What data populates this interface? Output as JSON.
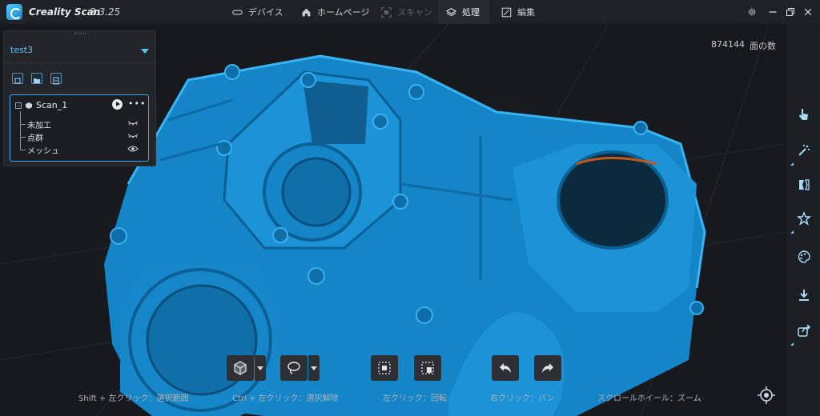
{
  "app": {
    "name": "Creality Scan",
    "version": "3.3.25"
  },
  "nav": {
    "tabs": [
      {
        "label": "デバイス",
        "icon": "device-icon",
        "state": "normal"
      },
      {
        "label": "ホームページ",
        "icon": "home-icon",
        "state": "normal"
      },
      {
        "label": "スキャン",
        "icon": "scan-icon",
        "state": "disabled"
      },
      {
        "label": "処理",
        "icon": "layers-icon",
        "state": "active"
      },
      {
        "label": "編集",
        "icon": "edit-icon",
        "state": "normal"
      }
    ]
  },
  "window_controls": [
    "settings-icon",
    "minimize-icon",
    "restore-icon",
    "close-icon"
  ],
  "stats": {
    "face_count": "874144",
    "face_label": "面の数"
  },
  "project": {
    "selected": "test3",
    "tools": [
      "import-icon",
      "folder-icon",
      "export-icon"
    ],
    "scan": {
      "name": "Scan_1",
      "children": [
        {
          "label": "未加工",
          "visibility": "hidden"
        },
        {
          "label": "点群",
          "visibility": "hidden"
        },
        {
          "label": "メッシュ",
          "visibility": "visible"
        }
      ]
    }
  },
  "right_toolbar": [
    "pointer-icon",
    "magic-select-icon",
    "repair-icon",
    "star-icon",
    "palette-icon",
    "download-icon",
    "share-icon"
  ],
  "bottom_toolbar": [
    "view-cube-icon",
    "lasso-select-icon",
    "select-all-icon",
    "delete-selection-icon",
    "undo-icon",
    "redo-icon"
  ],
  "hints": [
    "Shift + 左クリック：選択範囲",
    "Ctrl + 左クリック：選択解除",
    "左クリック：回転",
    "右クリック：パン",
    "スクロールホイール：ズーム"
  ],
  "colors": {
    "accent": "#3aa7e3",
    "model": "#1a8fd1",
    "background": "#16191d"
  }
}
